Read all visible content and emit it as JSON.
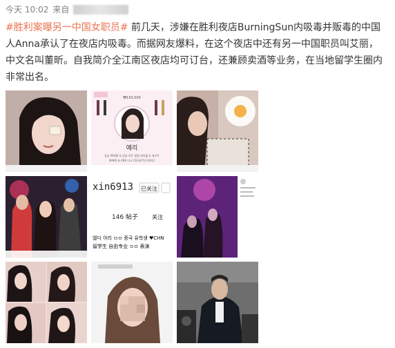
{
  "post": {
    "time": "今天 10:02",
    "source_prefix": "来自",
    "hashtag": "#胜利案曝另一中国女职员#",
    "body_text": " 前几天，涉嫌在胜利夜店BurningSun内吸毒并贩毒的中国人Anna承认了在夜店内吸毒。而据网友爆料，在这个夜店中还有另一中国职员叫艾丽，中文名叫董昕。自我简介全江南区夜店均可订台，还兼顾卖酒等业务，在当地留学生圈内非常出名。"
  },
  "images": {
    "img2": {
      "name": "예리",
      "line1": "강남 MADE & 강남 모든 클럽 테이블 & 게스트",
      "line2": "MAKE & ARK 다크 010-8713-0913",
      "price": "₩150,000"
    },
    "img5": {
      "username": "xin6913",
      "follow_button": "已关注",
      "stats": "146 帖子",
      "stats2": "关注",
      "bio1": "엘디 아리 ㅁㅁ 중국 유학생 ♥CHN",
      "bio2": "留学生 自由专业 ㅁㅁ 表演"
    }
  },
  "colors": {
    "hashtag": "#eb7350",
    "text": "#333333",
    "meta": "#808080"
  }
}
